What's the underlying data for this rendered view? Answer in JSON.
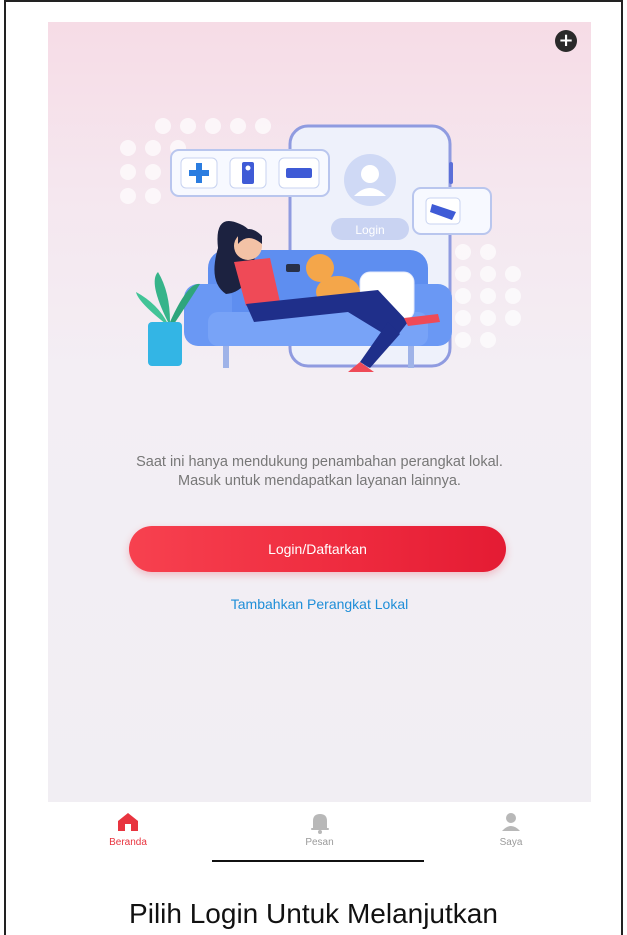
{
  "header": {
    "add_icon": "plus-circle-icon"
  },
  "illustration": {
    "login_badge": "Login",
    "device_icons": [
      "plus-icon",
      "doorbell-icon",
      "camera-box-icon"
    ],
    "camera_icon": "security-camera-icon",
    "avatar_icon": "user-avatar-icon"
  },
  "main": {
    "info_line1": "Saat ini hanya mendukung penambahan perangkat lokal.",
    "info_line2": "Masuk untuk mendapatkan layanan lainnya.",
    "login_button": "Login/Daftarkan",
    "add_local_link": "Tambahkan Perangkat Lokal"
  },
  "tabbar": {
    "items": [
      {
        "label": "Beranda",
        "icon": "home-icon",
        "active": true
      },
      {
        "label": "Pesan",
        "icon": "bell-icon",
        "active": false
      },
      {
        "label": "Saya",
        "icon": "user-icon",
        "active": false
      }
    ]
  },
  "caption": "Pilih Login Untuk Melanjutkan",
  "colors": {
    "accent": "#e8343f",
    "link": "#1f8ed8",
    "text_muted": "#777777"
  }
}
